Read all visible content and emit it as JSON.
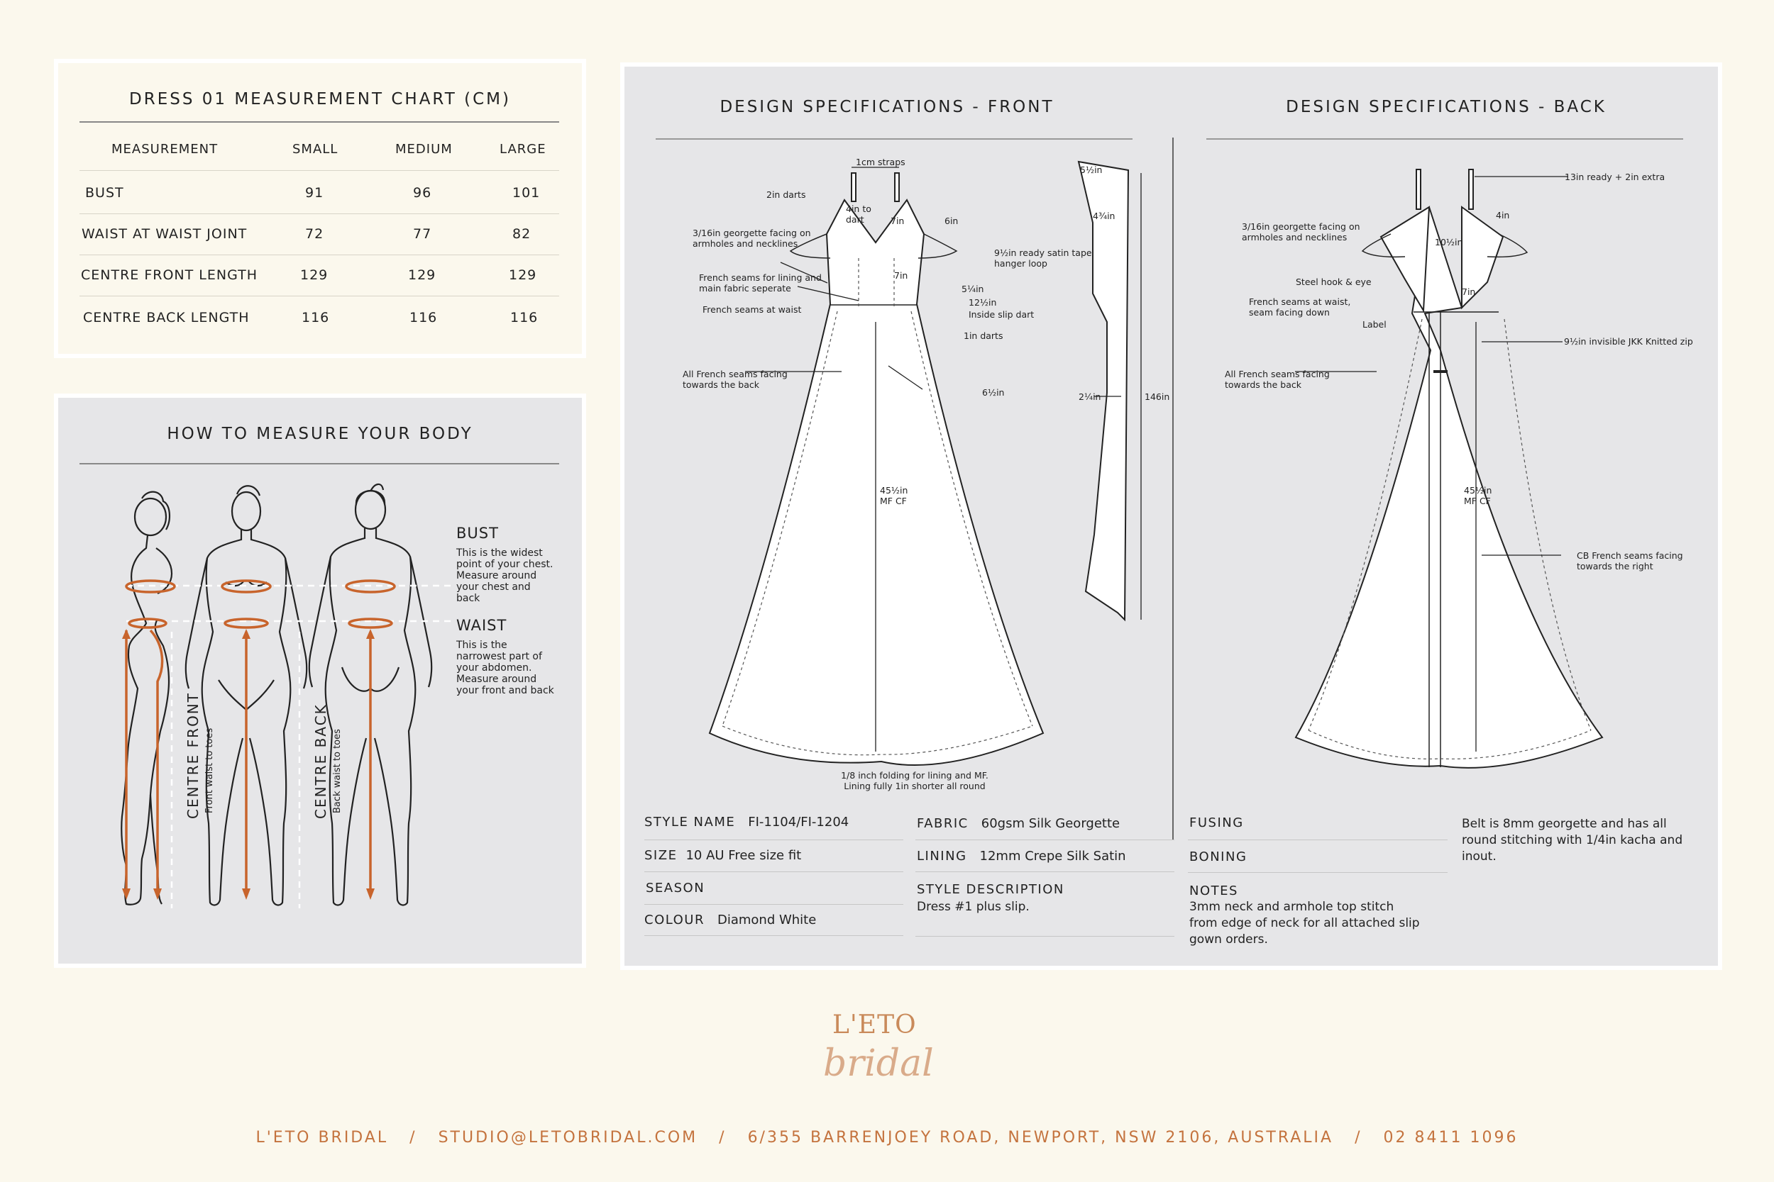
{
  "measurement_chart": {
    "title": "DRESS 01 MEASUREMENT CHART (CM)",
    "headers": [
      "MEASUREMENT",
      "SMALL",
      "MEDIUM",
      "LARGE"
    ],
    "rows": [
      [
        "BUST",
        "91",
        "96",
        "101"
      ],
      [
        "WAIST AT WAIST JOINT",
        "72",
        "77",
        "82"
      ],
      [
        "CENTRE FRONT LENGTH",
        "129",
        "129",
        "129"
      ],
      [
        "CENTRE BACK LENGTH",
        "116",
        "116",
        "116"
      ]
    ]
  },
  "how_to_measure": {
    "title": "HOW TO MEASURE YOUR BODY",
    "bust": {
      "label": "BUST",
      "text": "This is the widest point of your chest. Measure around your chest and back"
    },
    "waist": {
      "label": "WAIST",
      "text": "This is the narrowest part of your abdomen. Measure around your front and back"
    },
    "centre_front": {
      "label": "CENTRE FRONT",
      "sub": "Front waist to toes"
    },
    "centre_back": {
      "label": "CENTRE BACK",
      "sub": "Back waist to toes"
    }
  },
  "spec": {
    "front_title": "DESIGN SPECIFICATIONS - FRONT",
    "back_title": "DESIGN SPECIFICATIONS - BACK",
    "front_ann": {
      "straps": "1cm straps",
      "darts2": "2in darts",
      "dart4": "4in to dart",
      "in7": "7in",
      "in6": "6in",
      "facing": "3/16in georgette facing on armholes and necklines",
      "hanger": "9½in ready satin tape hanger loop",
      "seams_lining": "French seams for lining and main fabric seperate",
      "in7b": "7in",
      "in5": "5¼in",
      "in12": "12½in",
      "slip_dart": "Inside slip dart",
      "seams_waist": "French seams at waist",
      "darts1": "1in darts",
      "all_french": "All French seams facing towards the back",
      "in6half": "6½in",
      "mfcf": "45½in MF CF",
      "folding": "1/8 inch folding for lining and MF. Lining fully 1in shorter all round",
      "strap_top": "5½in",
      "strap_w": "4¾in",
      "strap_mid": "2¼in",
      "strap_len": "146in"
    },
    "back_ann": {
      "strap_extra": "13in ready + 2in extra",
      "facing": "3/16in georgette facing on armholes and necklines",
      "in4": "4in",
      "in10": "10½in",
      "hook": "Steel hook & eye",
      "seams_waist": "French seams at waist, seam facing down",
      "in7": "7in",
      "label": "Label",
      "zip": "9½in invisible JKK Knitted zip",
      "all_french": "All French seams facing towards the back",
      "mfcf": "45½in MF CF",
      "cb": "CB French seams facing towards the right"
    },
    "fields": {
      "style_name_k": "STYLE NAME",
      "style_name_v": "FI-1104/FI-1204",
      "size_k": "SIZE",
      "size_v": "10 AU Free size fit",
      "season_k": "SEASON",
      "colour_k": "COLOUR",
      "colour_v": "Diamond White",
      "fabric_k": "FABRIC",
      "fabric_v": "60gsm Silk Georgette",
      "lining_k": "LINING",
      "lining_v": "12mm Crepe Silk Satin",
      "style_desc_k": "STYLE DESCRIPTION",
      "style_desc_v": "Dress #1 plus slip.",
      "fusing_k": "FUSING",
      "boning_k": "BONING",
      "notes_k": "NOTES",
      "notes_v": "3mm neck and armhole top stitch from edge of neck for all attached slip gown orders.",
      "belt": "Belt is 8mm georgette and has all round stitching with 1/4in kacha and inout."
    }
  },
  "brand": {
    "logo_top": "L'ETO",
    "logo_script": "bridal"
  },
  "footer": [
    "L'ETO BRIDAL",
    "STUDIO@LETOBRIDAL.COM",
    "6/355 BARRENJOEY ROAD, NEWPORT, NSW 2106, AUSTRALIA",
    "02 8411 1096"
  ],
  "colors": {
    "background": "#fbf8ed",
    "panel": "#e6e6e8",
    "accent": "#c4733e",
    "measure_line": "#c8642c"
  }
}
